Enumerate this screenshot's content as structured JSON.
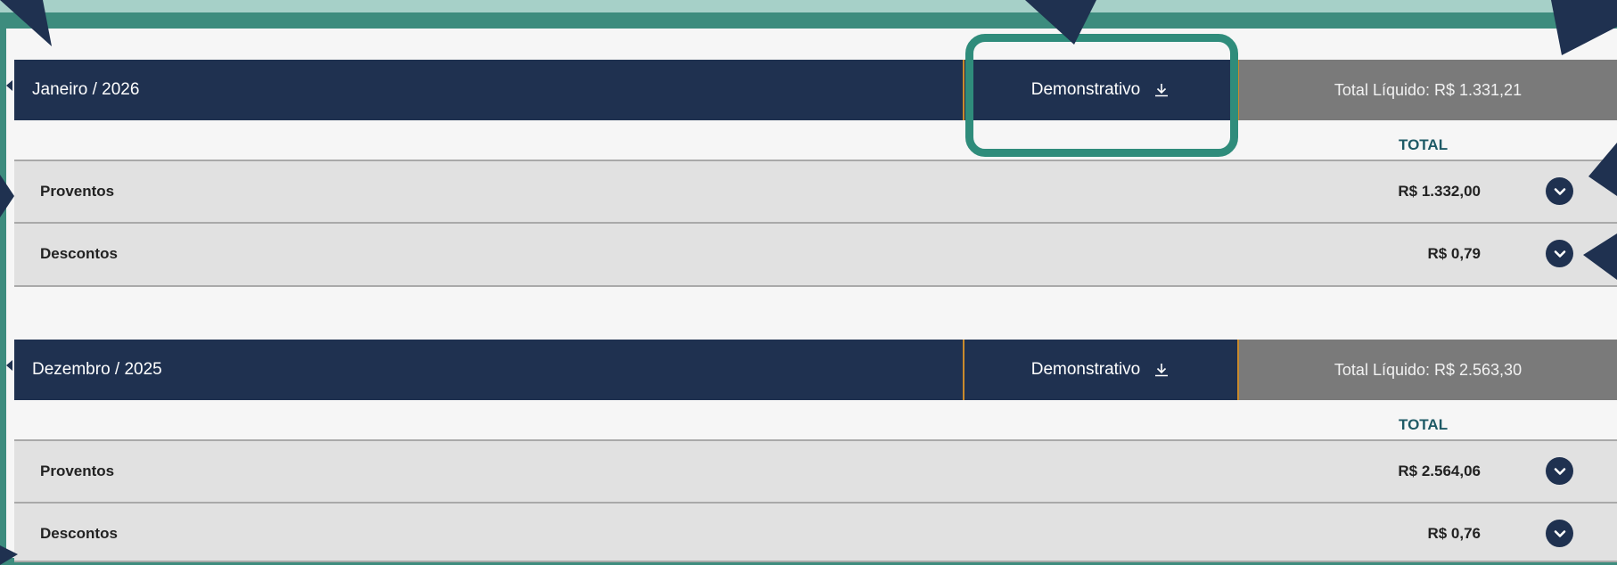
{
  "periods": [
    {
      "month": "Janeiro / 2026",
      "demonstrativo_label": "Demonstrativo",
      "total_liquido": "Total Líquido: R$ 1.331,21",
      "total_column_label": "TOTAL",
      "rows": [
        {
          "label": "Proventos",
          "value": "R$ 1.332,00"
        },
        {
          "label": "Descontos",
          "value": "R$ 0,79"
        }
      ]
    },
    {
      "month": "Dezembro / 2025",
      "demonstrativo_label": "Demonstrativo",
      "total_liquido": "Total Líquido: R$ 2.563,30",
      "total_column_label": "TOTAL",
      "rows": [
        {
          "label": "Proventos",
          "value": "R$ 2.564,06"
        },
        {
          "label": "Descontos",
          "value": "R$ 0,76"
        }
      ]
    }
  ],
  "icons": {
    "download": "download-icon",
    "expand": "chevron-down-icon"
  },
  "colors": {
    "header_bg": "#1f3150",
    "total_liquido_bg": "#7a7a7a",
    "highlight_border": "#2f8c7b",
    "total_label": "#1e5a66",
    "frame": "#3d8c7e"
  }
}
